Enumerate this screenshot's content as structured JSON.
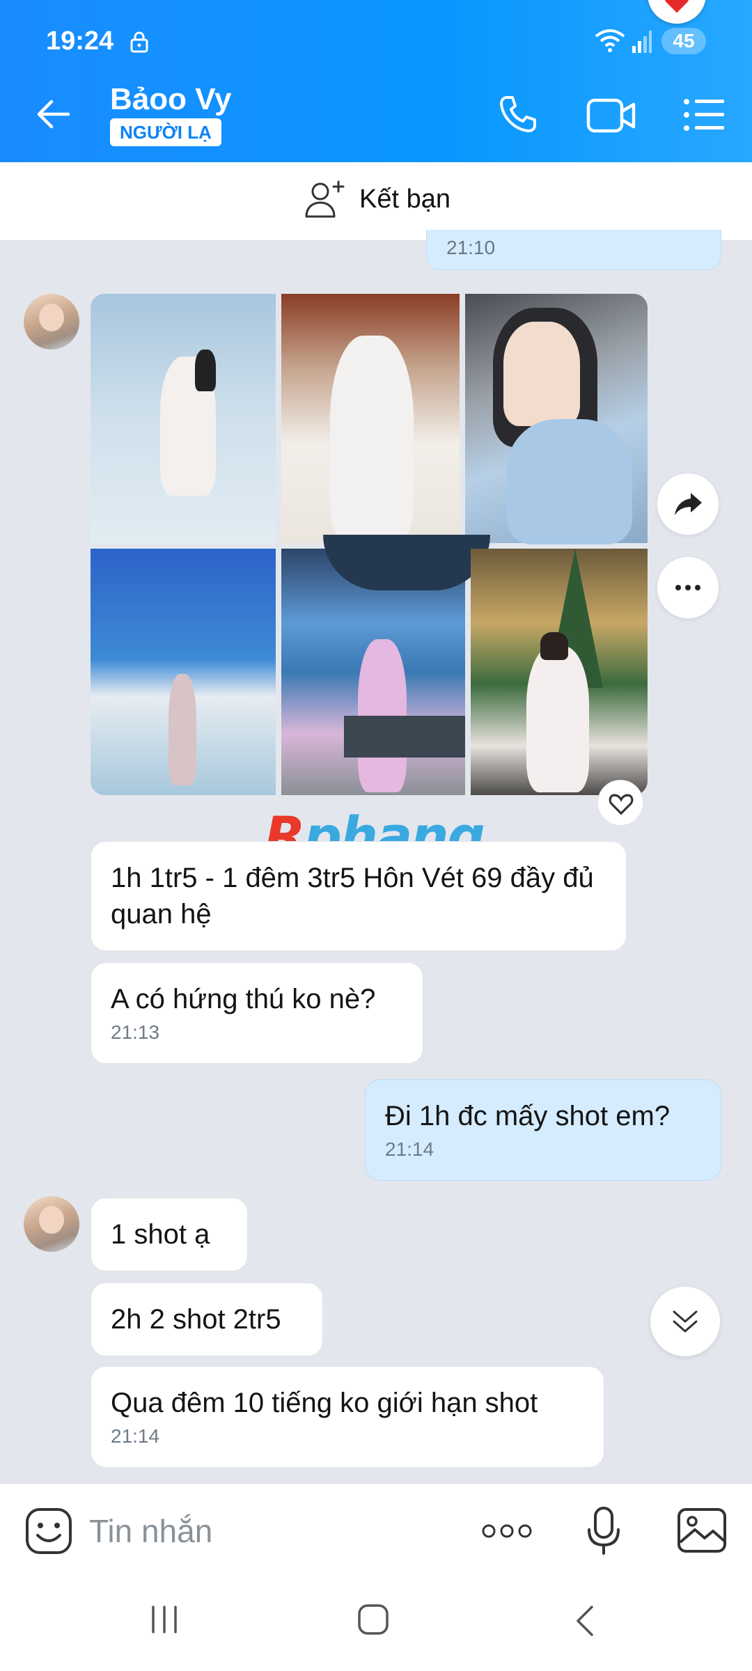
{
  "status_bar": {
    "time": "19:24",
    "battery": "45"
  },
  "header": {
    "contact_name": "Bảoo Vy",
    "badge": "NGƯỜI LẠ"
  },
  "add_friend": {
    "label": "Kết bạn"
  },
  "messages": {
    "prev_time": "21:10",
    "incoming_1": "1h 1tr5 - 1 đêm 3tr5 Hôn Vét 69 đầy đủ quan hệ",
    "incoming_2": "A có hứng thú ko nè?",
    "incoming_2_time": "21:13",
    "outgoing_1": "Đi 1h đc mấy shot em?",
    "outgoing_1_time": "21:14",
    "incoming_3": "1 shot ạ",
    "incoming_4": "2h 2 shot 2tr5",
    "incoming_5": "Qua đêm 10 tiếng ko giới hạn shot",
    "incoming_5_time": "21:14"
  },
  "watermark": {
    "part_a": "R",
    "part_b": "phang"
  },
  "input": {
    "placeholder": "Tin nhắn"
  },
  "icons": [
    "lock-icon",
    "wifi-icon",
    "signal-icon",
    "heart-icon",
    "back-arrow-icon",
    "phone-icon",
    "video-icon",
    "menu-icon",
    "add-friend-icon",
    "share-icon",
    "more-icon",
    "heart-outline-icon",
    "chevron-double-down-icon",
    "sticker-icon",
    "mic-icon",
    "gallery-icon"
  ],
  "colors": {
    "header": "#1a8cff",
    "my_bubble": "#d4ecfd",
    "chat_bg": "#e3e7ed"
  }
}
